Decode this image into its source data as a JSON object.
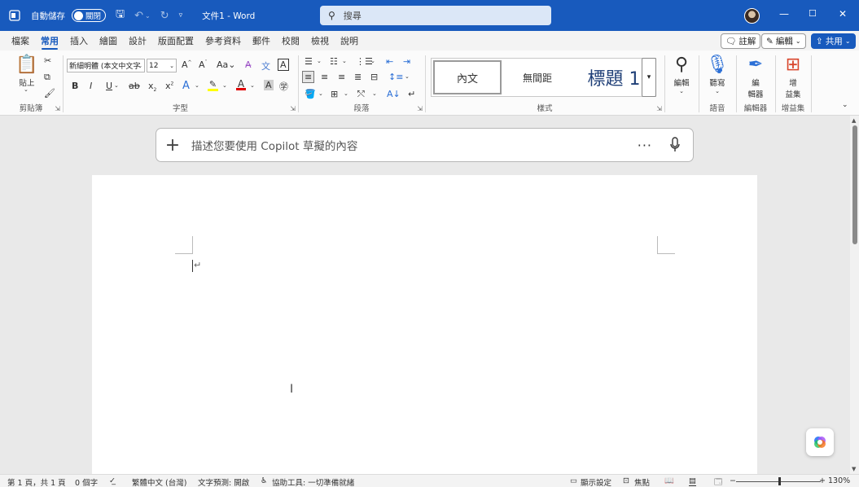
{
  "titlebar": {
    "autosave_label": "自動儲存",
    "autosave_state": "關閉",
    "doc_title": "文件1 - Word",
    "search_placeholder": "搜尋"
  },
  "tabs": [
    "檔案",
    "常用",
    "插入",
    "繪圖",
    "設計",
    "版面配置",
    "參考資料",
    "郵件",
    "校閱",
    "檢視",
    "說明"
  ],
  "active_tab": "常用",
  "top_actions": {
    "comments": "註解",
    "editing": "編輯",
    "share": "共用"
  },
  "ribbon": {
    "clipboard": {
      "label": "剪貼簿",
      "paste": "貼上"
    },
    "font": {
      "label": "字型",
      "font_name": "新細明體 (本文中文字",
      "font_size": "12"
    },
    "paragraph": {
      "label": "段落"
    },
    "styles": {
      "label": "樣式",
      "items": [
        "內文",
        "無間距",
        "標題 1"
      ]
    },
    "find": {
      "label": "編輯",
      "button": "編輯"
    },
    "voice": {
      "label": "語音",
      "button": "聽寫"
    },
    "editor": {
      "label": "編輯器",
      "button_line1": "編",
      "button_line2": "輯器"
    },
    "addins": {
      "label": "增益集",
      "button_line1": "增",
      "button_line2": "益集"
    }
  },
  "copilot": {
    "placeholder": "描述您要使用 Copilot 草擬的內容"
  },
  "status": {
    "page": "第 1 頁，共 1 頁",
    "words": "0 個字",
    "language": "繁體中文 (台灣)",
    "text_prediction": "文字預測: 開啟",
    "accessibility": "協助工具: 一切準備就緒",
    "display_settings": "顯示設定",
    "focus": "焦點",
    "zoom": "130%"
  },
  "colors": {
    "brand": "#185abd",
    "highlight": "#ffff00",
    "font_color": "#e00000"
  }
}
